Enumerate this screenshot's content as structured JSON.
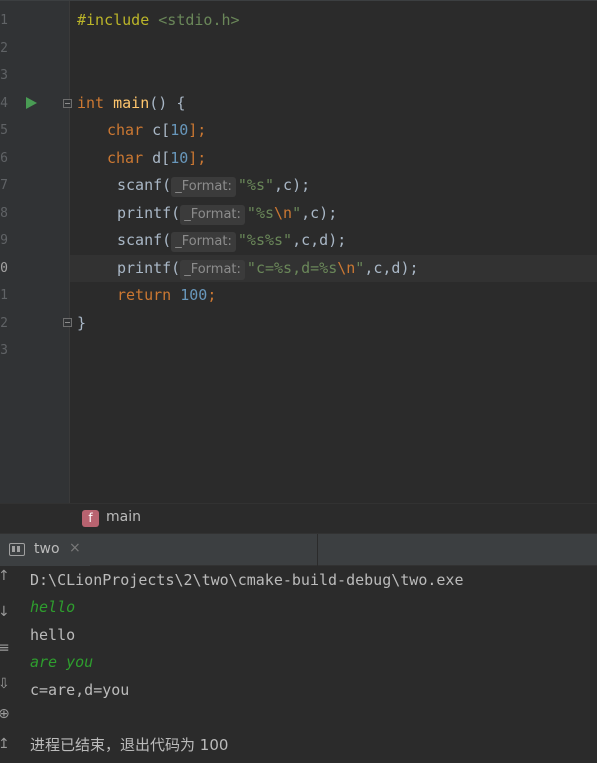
{
  "editor": {
    "line_numbers": [
      "1",
      "2",
      "3",
      "4",
      "5",
      "6",
      "7",
      "8",
      "9",
      "0",
      "1",
      "2",
      "3"
    ],
    "line1": {
      "directive": "#include",
      "header": "<stdio.h>"
    },
    "line4": {
      "type": "int",
      "name": "main",
      "parens": "() {"
    },
    "line5": {
      "type": "char",
      "decl": " c[",
      "size": "10",
      "end": "];"
    },
    "line6": {
      "type": "char",
      "decl": " d[",
      "size": "10",
      "end": "];"
    },
    "line7": {
      "call": "scanf(",
      "hint": "_Format:",
      "str": "\"%s\"",
      "rest": ",c);"
    },
    "line8": {
      "call": "printf(",
      "hint": "_Format:",
      "str1": "\"%s",
      "esc": "\\n",
      "str2": "\"",
      "rest": ",c);"
    },
    "line9": {
      "call": "scanf(",
      "hint": "_Format:",
      "str": "\"%s%s\"",
      "rest": ",c,d);"
    },
    "line10": {
      "call": "printf(",
      "hint": "_Format:",
      "str1": "\"c=%s,d=%s",
      "esc": "\\n",
      "str2": "\"",
      "rest": ",c,d);"
    },
    "line11": {
      "kw": "return",
      "value": "100",
      "end": ";"
    },
    "line12": {
      "brace": "}"
    }
  },
  "breadcrumb": {
    "badge": "f",
    "label": "main"
  },
  "run_panel": {
    "tab_label": "two",
    "close": "×"
  },
  "console": {
    "side_glyphs": [
      "↑",
      "↓",
      "≡",
      "⇩",
      "⊕",
      "↥"
    ],
    "lines": [
      {
        "text": "D:\\CLionProjects\\2\\two\\cmake-build-debug\\two.exe",
        "kind": "path"
      },
      {
        "text": "hello",
        "kind": "input"
      },
      {
        "text": "hello",
        "kind": "output"
      },
      {
        "text": "are you",
        "kind": "input"
      },
      {
        "text": "c=are,d=you",
        "kind": "output"
      },
      {
        "text": "",
        "kind": "blank"
      },
      {
        "text": "进程已结束，退出代码为 100",
        "kind": "status"
      }
    ]
  },
  "colors": {
    "background": "#2b2b2b",
    "keyword": "#cc7832",
    "function": "#ffc66d",
    "number": "#6897bb",
    "string": "#6a8759",
    "console_input": "#2e9e2e",
    "run_icon": "#499c54"
  },
  "icons": [
    "run-gutter-icon",
    "fold-icon",
    "function-badge-icon",
    "terminal-icon",
    "close-icon"
  ]
}
